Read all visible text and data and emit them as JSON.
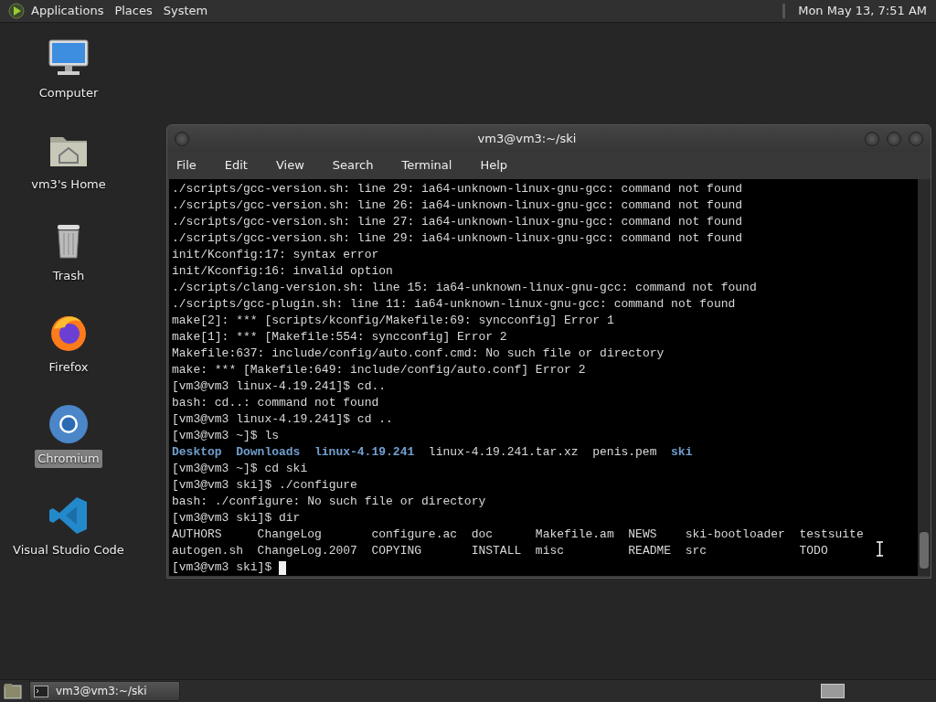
{
  "top_panel": {
    "menus": [
      "Applications",
      "Places",
      "System"
    ],
    "clock": "Mon May 13,  7:51 AM"
  },
  "desktop_icons": [
    {
      "label": "Computer",
      "kind": "computer",
      "selected": false
    },
    {
      "label": "vm3's Home",
      "kind": "home",
      "selected": false
    },
    {
      "label": "Trash",
      "kind": "trash",
      "selected": false
    },
    {
      "label": "Firefox",
      "kind": "firefox",
      "selected": false
    },
    {
      "label": "Chromium",
      "kind": "chromium",
      "selected": true
    },
    {
      "label": "Visual Studio Code",
      "kind": "vscode",
      "selected": false
    }
  ],
  "window": {
    "title": "vm3@vm3:~/ski",
    "menu": [
      "File",
      "Edit",
      "View",
      "Search",
      "Terminal",
      "Help"
    ],
    "terminal_lines": [
      {
        "kind": "text",
        "text": "./scripts/gcc-version.sh: line 29: ia64-unknown-linux-gnu-gcc: command not found"
      },
      {
        "kind": "text",
        "text": "./scripts/gcc-version.sh: line 26: ia64-unknown-linux-gnu-gcc: command not found"
      },
      {
        "kind": "text",
        "text": "./scripts/gcc-version.sh: line 27: ia64-unknown-linux-gnu-gcc: command not found"
      },
      {
        "kind": "text",
        "text": "./scripts/gcc-version.sh: line 29: ia64-unknown-linux-gnu-gcc: command not found"
      },
      {
        "kind": "text",
        "text": "init/Kconfig:17: syntax error"
      },
      {
        "kind": "text",
        "text": "init/Kconfig:16: invalid option"
      },
      {
        "kind": "text",
        "text": "./scripts/clang-version.sh: line 15: ia64-unknown-linux-gnu-gcc: command not found"
      },
      {
        "kind": "text",
        "text": "./scripts/gcc-plugin.sh: line 11: ia64-unknown-linux-gnu-gcc: command not found"
      },
      {
        "kind": "text",
        "text": "make[2]: *** [scripts/kconfig/Makefile:69: syncconfig] Error 1"
      },
      {
        "kind": "text",
        "text": "make[1]: *** [Makefile:554: syncconfig] Error 2"
      },
      {
        "kind": "text",
        "text": "Makefile:637: include/config/auto.conf.cmd: No such file or directory"
      },
      {
        "kind": "text",
        "text": "make: *** [Makefile:649: include/config/auto.conf] Error 2"
      },
      {
        "kind": "text",
        "text": "[vm3@vm3 linux-4.19.241]$ cd.."
      },
      {
        "kind": "text",
        "text": "bash: cd..: command not found"
      },
      {
        "kind": "text",
        "text": "[vm3@vm3 linux-4.19.241]$ cd .."
      },
      {
        "kind": "text",
        "text": "[vm3@vm3 ~]$ ls"
      },
      {
        "kind": "listing",
        "items": [
          {
            "text": "Desktop",
            "kind": "dir"
          },
          {
            "text": "Downloads",
            "kind": "dir"
          },
          {
            "text": "linux-4.19.241",
            "kind": "dir"
          },
          {
            "text": "linux-4.19.241.tar.xz",
            "kind": "file"
          },
          {
            "text": "penis.pem",
            "kind": "file"
          },
          {
            "text": "ski",
            "kind": "dir"
          }
        ]
      },
      {
        "kind": "text",
        "text": "[vm3@vm3 ~]$ cd ski"
      },
      {
        "kind": "text",
        "text": "[vm3@vm3 ski]$ ./configure"
      },
      {
        "kind": "text",
        "text": "bash: ./configure: No such file or directory"
      },
      {
        "kind": "text",
        "text": "[vm3@vm3 ski]$ dir"
      },
      {
        "kind": "text",
        "text": "AUTHORS     ChangeLog       configure.ac  doc      Makefile.am  NEWS    ski-bootloader  testsuite"
      },
      {
        "kind": "text",
        "text": "autogen.sh  ChangeLog.2007  COPYING       INSTALL  misc         README  src             TODO"
      },
      {
        "kind": "prompt",
        "text": "[vm3@vm3 ski]$ ",
        "cursor": true
      }
    ]
  },
  "taskbar": {
    "tasks": [
      {
        "label": "vm3@vm3:~/ski",
        "selected": false
      }
    ]
  }
}
